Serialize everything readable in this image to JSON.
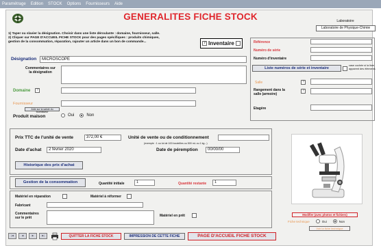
{
  "menu": [
    "Paramétrage",
    "Edition",
    "STOCK",
    "Options",
    "Fournisseurs",
    "Aide"
  ],
  "title": "GENERALITES FICHE STOCK",
  "instructions": {
    "line1": "1) Taper ou slavier la désignation. Choisir dans une liste déroulante : domaine, fournisseur, salle.",
    "line2": "2) Cliquer sur PAGE D'ACCUEIL FICHE STOCK pour des pages spécifiques : produits chimiques,",
    "line3": "gestion de la consommation, réparation, rajouter un article dans un bon de commande..."
  },
  "lab": {
    "label": "Laboratoire",
    "value": "Laboratoire de Physique-Chimie"
  },
  "inventaire": "Inventaire",
  "left": {
    "designation_label": "Désignation",
    "designation_value": "MICROSCOPE",
    "commentaires_label_1": "Commentaires sur",
    "commentaires_label_2": "la désignation",
    "domaine_label": "Domaine",
    "fournisseur_label": "Fournisseur",
    "fournisseur_btn": "Aide sur la saisie du fournisseur",
    "produit_maison_label": "Produit maison",
    "oui": "Oui",
    "non": "Non",
    "question_mark": "?"
  },
  "right": {
    "reference_label": "Référence",
    "numero_serie_label": "Numéro de série",
    "numero_inventaire_label": "Numéro d'inventaire",
    "liste_btn": "Liste numéros de série et inventaire",
    "liste_note_1": "case cochée si la liste",
    "liste_note_2": "apparent des éléments",
    "salle_label": "Salle",
    "rangement_label_1": "Rangement dans la",
    "rangement_label_2": "salle (armoire)",
    "etagere_label": "Etagère"
  },
  "price": {
    "prix_label": "Prix TTC de l'unité de vente",
    "prix_value": "372,00 €",
    "unite_label": "Unité de vente ou de conditionnement",
    "unite_example": "(exemple : 1 ou lot de 100 bouteilles ou 500 mL ou 1 kg...)",
    "achat_label": "Date d'achat",
    "achat_value": "2 février 2020",
    "peremption_label": "Date de péremption",
    "peremption_value": "00/00/00",
    "historique_btn": "Historique des prix d'achat"
  },
  "consumption": {
    "gestion_btn": "Gestion de la consommation",
    "quantite_initiale_label": "Quantité initiale",
    "quantite_initiale_value": "1",
    "quantite_restante_label": "Quantité restante",
    "quantite_restante_value": "1"
  },
  "repair": {
    "reparation_label": "Matériel en réparation",
    "reformer_label": "Matériel à réformer",
    "fabricant_label": "Fabricant",
    "comm_pret_label_1": "Commentaires",
    "comm_pret_label_2": "sur le prêt",
    "pret_label": "Matériel en prêt"
  },
  "photo_panel": {
    "modifier_btn": "Modifier (avec photos et fichiers)",
    "fiche_technique_label": "Fiche technique",
    "oui": "Oui",
    "non": "Non",
    "voir_btn": "Voir la fiche technique"
  },
  "bottom": {
    "nav": [
      "|◀",
      "◀",
      "▶",
      "▶|"
    ],
    "quitter": "QUITTER LA FICHE STOCK",
    "impression": "IMPRESSION DE CETTE FICHE",
    "accueil": "PAGE D'ACCUEIL FICHE STOCK"
  },
  "colors": {
    "title_red": "#e0262c",
    "label_red": "#d8343a",
    "domaine_green": "#4a9a3d",
    "fournisseur_orange": "#e8944e",
    "button_blue": "#1a2d7a",
    "menu_bar": "#9aa7b8"
  },
  "icons": [
    "app-logo-icon",
    "printer-icon",
    "microscope-photo"
  ]
}
